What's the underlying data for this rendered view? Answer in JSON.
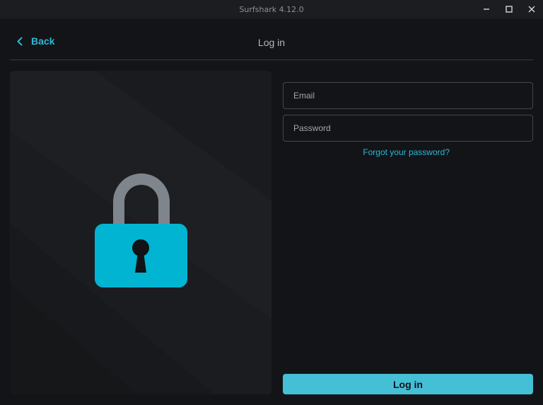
{
  "window": {
    "title": "Surfshark 4.12.0",
    "controls": [
      "minimize-icon",
      "maximize-icon",
      "close-icon"
    ]
  },
  "header": {
    "back_label": "Back",
    "title": "Log in"
  },
  "illustration": {
    "icon": "padlock-icon",
    "colors": {
      "body": "#00b4d2",
      "shackle": "#7f858c",
      "keyhole": "#111317"
    }
  },
  "form": {
    "email": {
      "placeholder": "Email",
      "value": ""
    },
    "password": {
      "placeholder": "Password",
      "value": ""
    },
    "forgot_label": "Forgot your password?",
    "submit_label": "Log in"
  },
  "colors": {
    "accent": "#2bb8d6",
    "button": "#45bfd6",
    "background": "#131418"
  }
}
